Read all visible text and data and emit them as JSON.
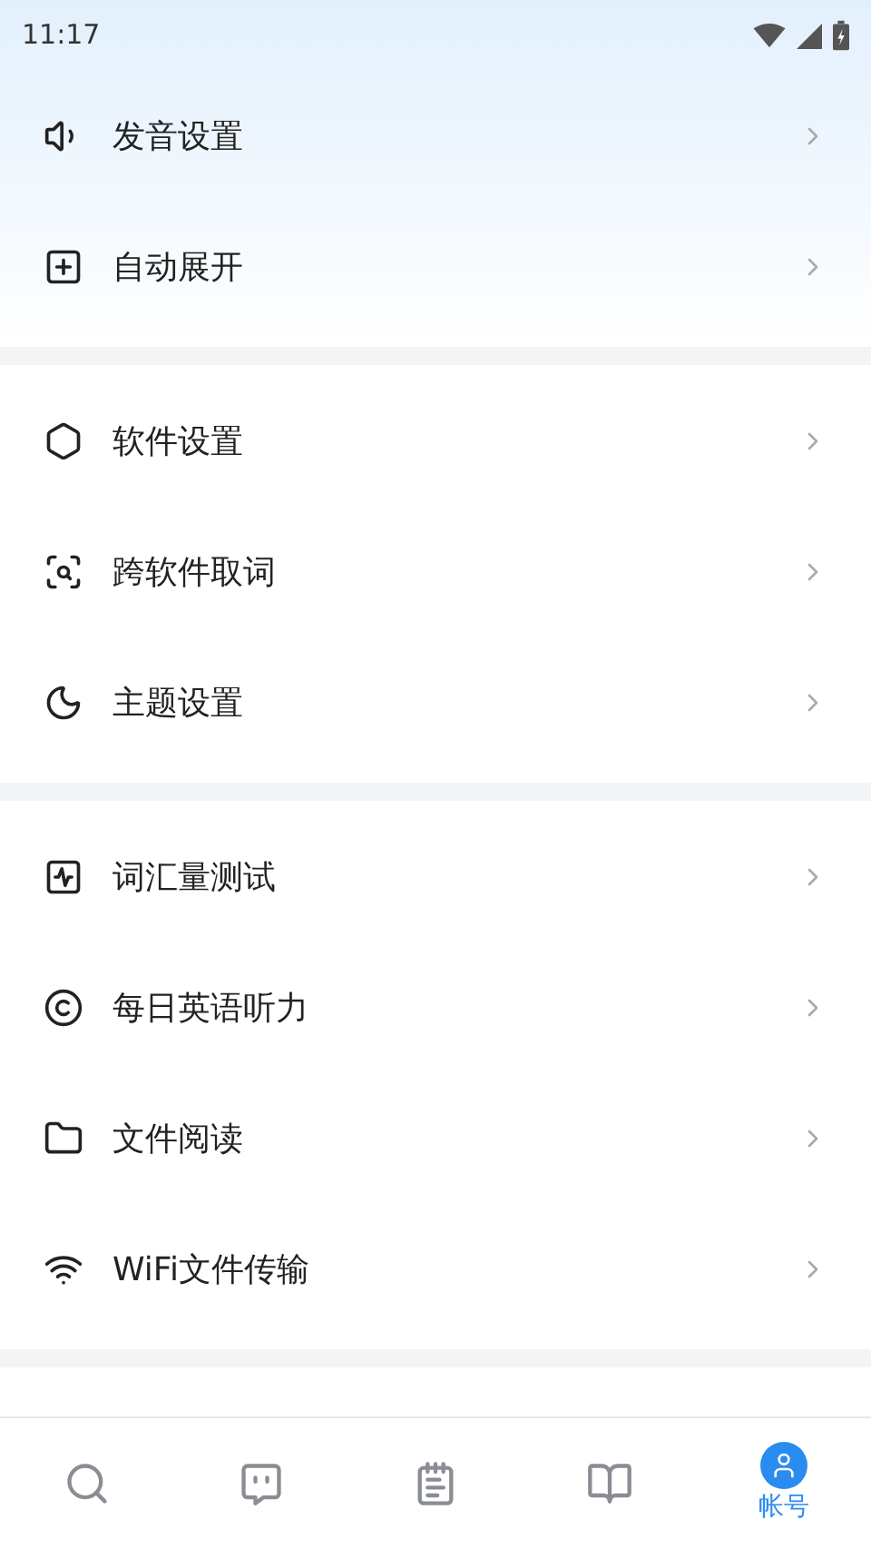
{
  "status_bar": {
    "time": "11:17"
  },
  "groups": [
    {
      "items": [
        {
          "kind": "sound",
          "label": "发音设置"
        },
        {
          "kind": "expand",
          "label": "自动展开"
        }
      ]
    },
    {
      "items": [
        {
          "kind": "settings",
          "label": "软件设置"
        },
        {
          "kind": "lookup",
          "label": "跨软件取词"
        },
        {
          "kind": "theme",
          "label": "主题设置"
        }
      ]
    },
    {
      "items": [
        {
          "kind": "vocab",
          "label": "词汇量测试"
        },
        {
          "kind": "listening",
          "label": "每日英语听力"
        },
        {
          "kind": "file",
          "label": "文件阅读"
        },
        {
          "kind": "wifi",
          "label": "WiFi文件传输"
        }
      ]
    }
  ],
  "bottom_nav": [
    {
      "kind": "search",
      "selected": false
    },
    {
      "kind": "chat",
      "selected": false
    },
    {
      "kind": "notes",
      "selected": false
    },
    {
      "kind": "book",
      "selected": false
    },
    {
      "kind": "account",
      "label": "帐号",
      "selected": true
    }
  ]
}
